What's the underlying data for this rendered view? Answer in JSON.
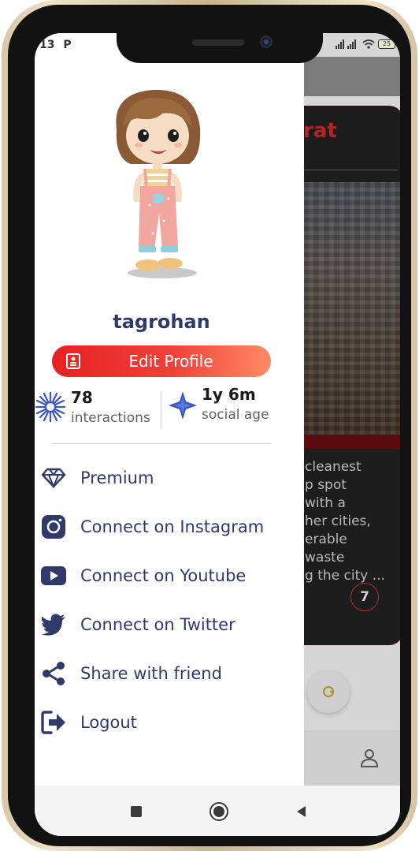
{
  "status_bar": {
    "left_text": "13",
    "left_icon": "p-icon",
    "battery": "25"
  },
  "background_app": {
    "card_title": "rat",
    "card_text": "cleanest\np spot\nwith a\nher cities,\nerable\nwaste\ng the city ...",
    "card_badge": "7",
    "fab_icon": "refresh-icon",
    "bottom_icon": "person-icon"
  },
  "drawer": {
    "avatar_icon": "cartoon-girl-avatar",
    "username": "tagrohan",
    "edit_profile_label": "Edit Profile",
    "stats": [
      {
        "value": "78",
        "label": "interactions",
        "icon": "burst-icon"
      },
      {
        "value": "1y 6m",
        "label": "social age",
        "icon": "star-burst-icon"
      }
    ],
    "menu": [
      {
        "label": "Premium",
        "icon": "diamond-icon"
      },
      {
        "label": "Connect on Instagram",
        "icon": "instagram-icon"
      },
      {
        "label": "Connect on Youtube",
        "icon": "youtube-icon"
      },
      {
        "label": "Connect on Twitter",
        "icon": "twitter-icon"
      },
      {
        "label": "Share with friend",
        "icon": "share-icon"
      },
      {
        "label": "Logout",
        "icon": "logout-icon"
      }
    ]
  },
  "colors": {
    "accent_navy": "#2f3a6b",
    "edit_gradient_start": "#e62121",
    "edit_gradient_end": "#ff8a67",
    "stat_icon_blue": "#3a56c4"
  }
}
